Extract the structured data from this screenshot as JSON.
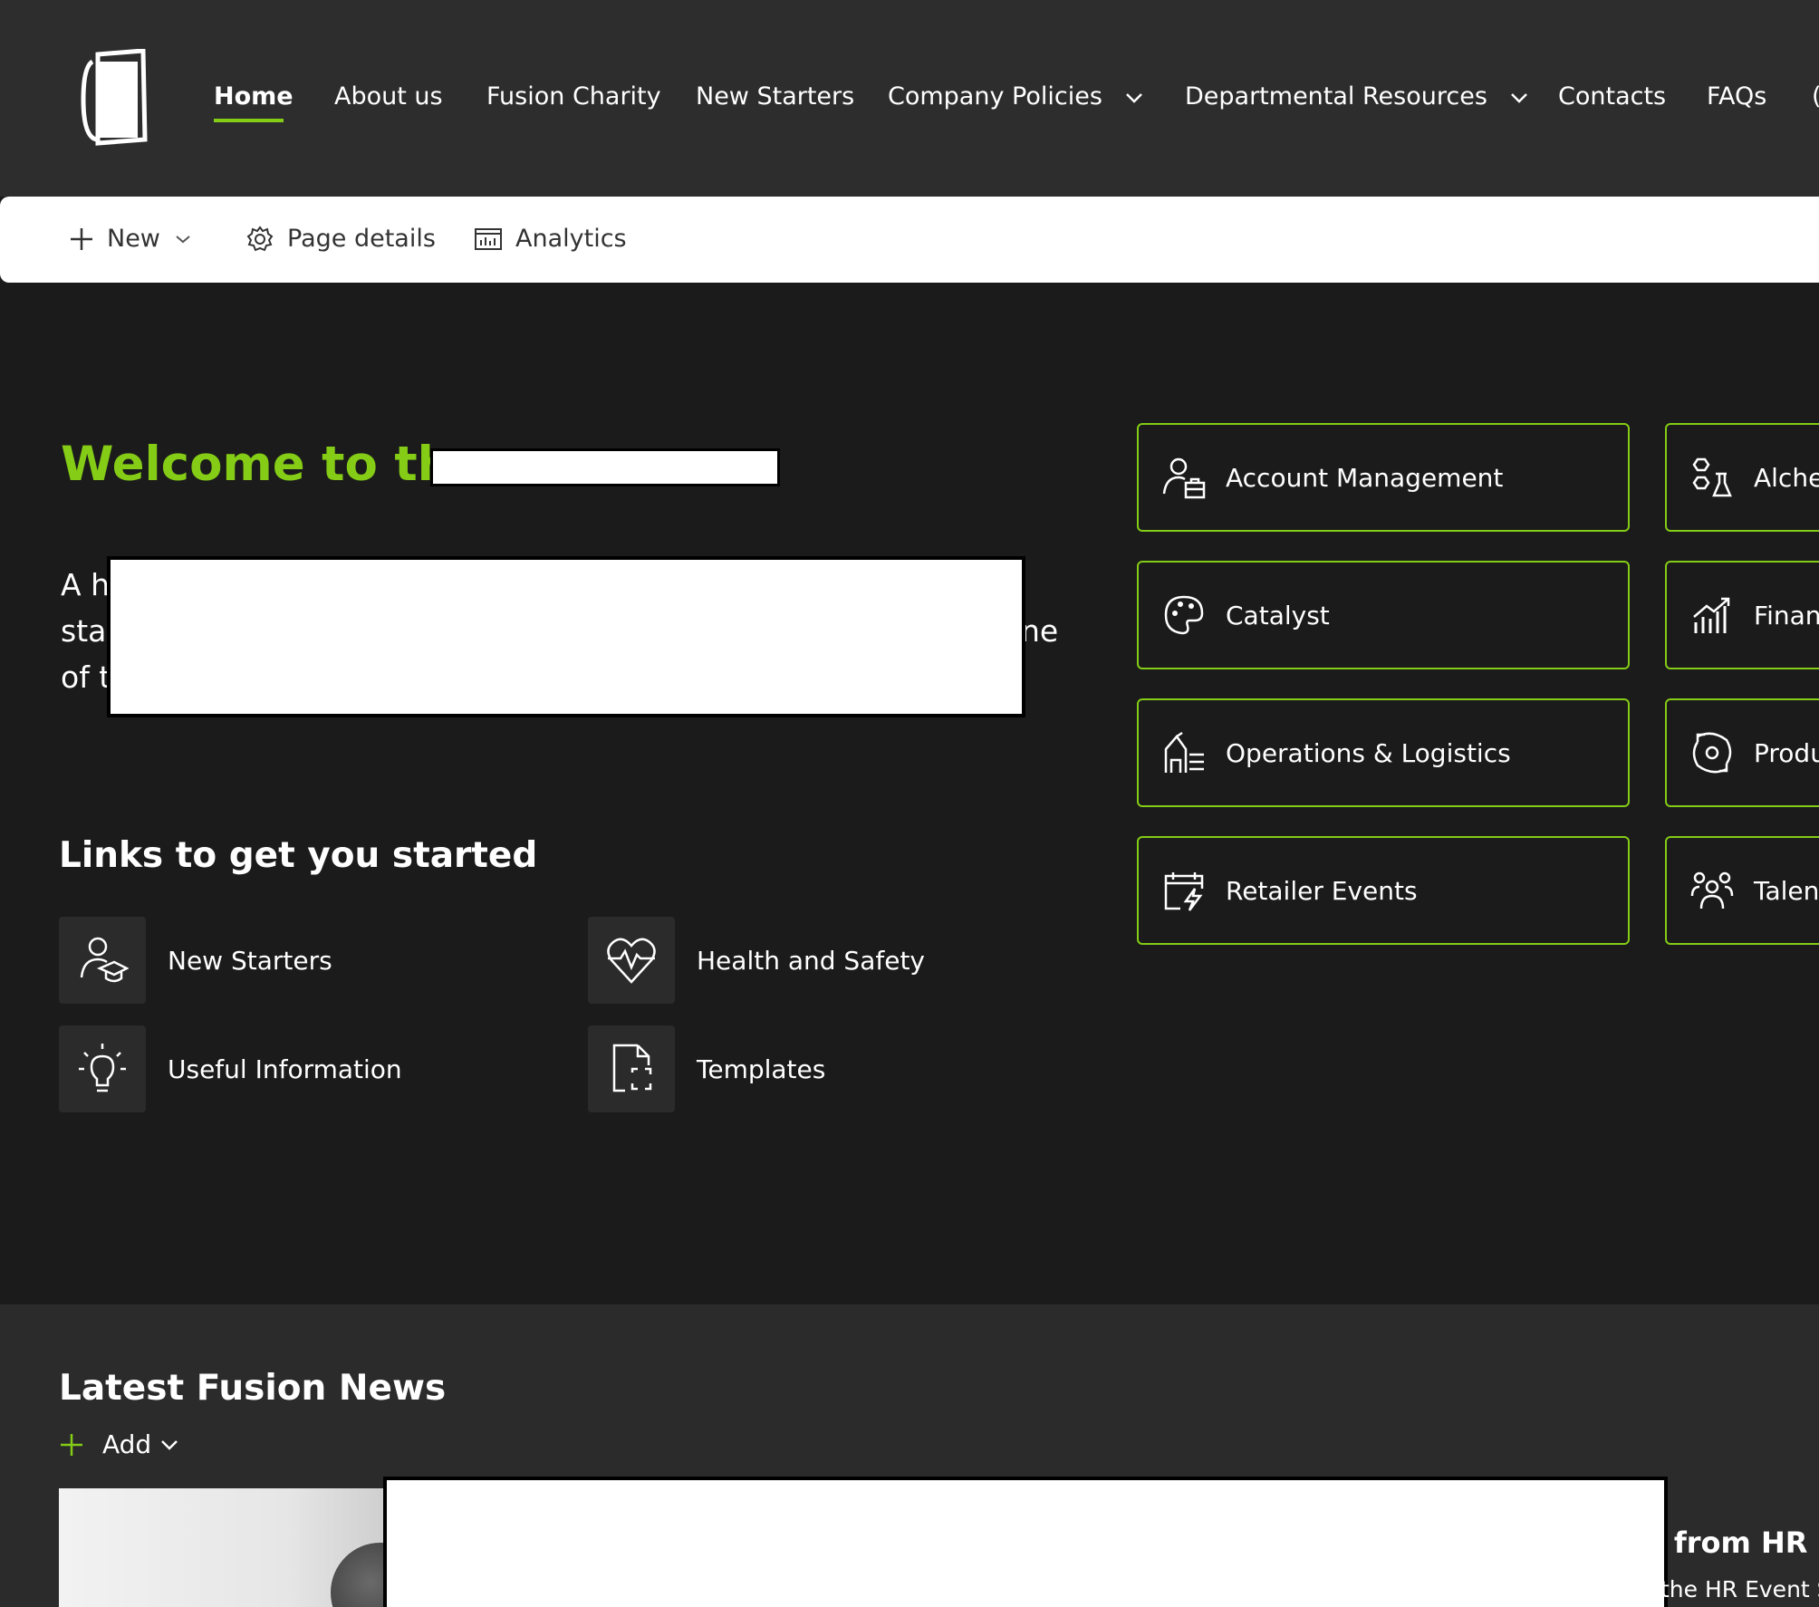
{
  "nav": {
    "items": [
      {
        "label": "Home",
        "active": true
      },
      {
        "label": "About us"
      },
      {
        "label": "Fusion Charity"
      },
      {
        "label": "New Starters"
      },
      {
        "label": "Company Policies",
        "dropdown": true
      },
      {
        "label": "Departmental Resources",
        "dropdown": true
      },
      {
        "label": "Contacts"
      },
      {
        "label": "FAQs"
      }
    ]
  },
  "toolbar": {
    "new_label": "New",
    "page_details_label": "Page details",
    "analytics_label": "Analytics"
  },
  "hero": {
    "welcome_text": "Welcome to the",
    "intro_lines": [
      "A h",
      "star",
      "of t"
    ],
    "intro_tail": "ne"
  },
  "quick_links": {
    "title": "Links to get you started",
    "items": [
      {
        "label": "New Starters",
        "icon": "graduate-user-icon"
      },
      {
        "label": "Health and Safety",
        "icon": "heart-pulse-icon"
      },
      {
        "label": "Useful Information",
        "icon": "lightbulb-icon"
      },
      {
        "label": "Templates",
        "icon": "document-template-icon"
      }
    ]
  },
  "departments": {
    "tiles": [
      {
        "label": "Account Management",
        "icon": "user-briefcase-icon"
      },
      {
        "label": "Alcher",
        "icon": "flask-icon"
      },
      {
        "label": "Catalyst",
        "icon": "palette-icon"
      },
      {
        "label": "Financ",
        "icon": "chart-growth-icon"
      },
      {
        "label": "Operations & Logistics",
        "icon": "warehouse-icon"
      },
      {
        "label": "Produ",
        "icon": "gear-cycle-icon"
      },
      {
        "label": "Retailer Events",
        "icon": "calendar-flash-icon"
      },
      {
        "label": "Talent",
        "icon": "people-group-icon"
      }
    ],
    "accent": "#84cc16"
  },
  "news": {
    "title": "Latest Fusion News",
    "add_label": "Add",
    "headline_partial": "e from HR po",
    "sub_partial": "the HR Event S"
  },
  "colors": {
    "accent": "#84cc16",
    "topbar": "#2d2d2d",
    "background": "#1b1b1b"
  }
}
